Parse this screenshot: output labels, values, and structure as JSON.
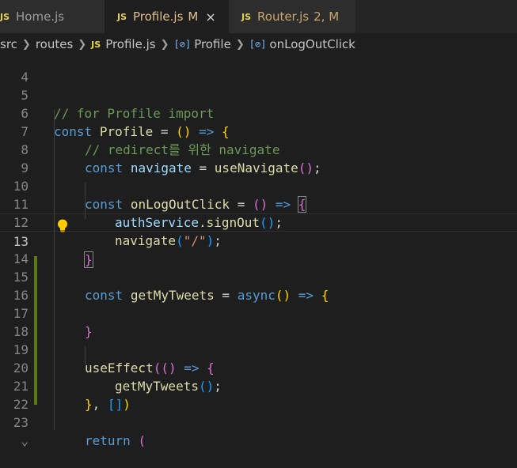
{
  "tabs": [
    {
      "icon": "JS",
      "label": "Home.js"
    },
    {
      "icon": "JS",
      "label": "Profile.js",
      "badge": "M",
      "close": "×"
    },
    {
      "icon": "JS",
      "label": "Router.js",
      "badge": "2, M"
    }
  ],
  "breadcrumb": {
    "items": [
      "src",
      "routes",
      "Profile.js",
      "Profile",
      "onLogOutClick"
    ],
    "file_icon": "JS",
    "symbol_icon": "[⊘]"
  },
  "editor": {
    "current_line": 13,
    "lines": [
      {
        "n": "4"
      },
      {
        "n": "5",
        "t": "// for Profile import"
      },
      {
        "n": "6",
        "t": "const Profile = () => {"
      },
      {
        "n": "7",
        "t": "// redirect를 위한 navigate"
      },
      {
        "n": "8",
        "t": "const navigate = useNavigate();"
      },
      {
        "n": "9"
      },
      {
        "n": "10",
        "t": "const onLogOutClick = () => {"
      },
      {
        "n": "11",
        "t": "authService.signOut();"
      },
      {
        "n": "12",
        "t": "navigate(\"/\");"
      },
      {
        "n": "13",
        "t": "}"
      },
      {
        "n": "14"
      },
      {
        "n": "15",
        "t": "const getMyTweets = async() => {"
      },
      {
        "n": "16"
      },
      {
        "n": "17",
        "t": "}"
      },
      {
        "n": "18"
      },
      {
        "n": "19",
        "t": "useEffect(() => {"
      },
      {
        "n": "20",
        "t": "getMyTweets();"
      },
      {
        "n": "21",
        "t": "}, [])"
      },
      {
        "n": "22"
      },
      {
        "n": "23",
        "t": "return ("
      }
    ]
  },
  "colors": {
    "background": "#1e1e1e",
    "tabbar": "#252526",
    "git_added": "#587c0c",
    "lightbulb": "#ffcc00"
  }
}
